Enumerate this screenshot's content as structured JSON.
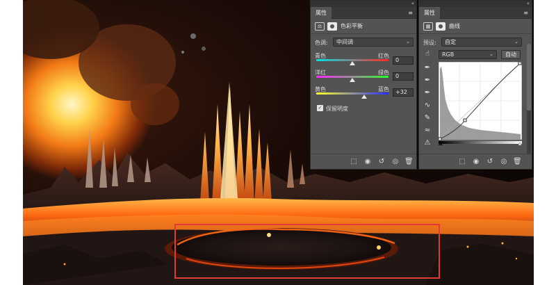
{
  "colors": {
    "panel_bg": "#535353",
    "header_bg": "#383838",
    "highlight": "#e33a33"
  },
  "color_balance_panel": {
    "tab_label": "属性",
    "title": "色彩平衡",
    "tone_label": "色调:",
    "tone_value": "中间调",
    "sliders": [
      {
        "left": "青色",
        "right": "红色",
        "value": "0",
        "level": 0
      },
      {
        "left": "洋红",
        "right": "绿色",
        "value": "0",
        "level": 0
      },
      {
        "left": "黄色",
        "right": "蓝色",
        "value": "+32",
        "level": 32
      }
    ],
    "preserve_label": "保留明度",
    "preserve_checked": true,
    "icons": [
      "adjustment-icon",
      "mask-icon",
      "menu-icon",
      "clip-layer-icon",
      "view-previous-icon",
      "reset-icon",
      "visibility-icon",
      "trash-icon"
    ]
  },
  "curves_panel": {
    "tab_label": "属性",
    "title": "曲线",
    "preset_label": "预设:",
    "preset_value": "自定",
    "channel_value": "RGB",
    "auto_label": "自动",
    "icons": [
      "on-image-adjust-icon",
      "black-point-eyedropper-icon",
      "gray-point-eyedropper-icon",
      "white-point-eyedropper-icon",
      "curve-points-icon",
      "pencil-icon",
      "smooth-icon",
      "clipping-warning-icon"
    ]
  }
}
